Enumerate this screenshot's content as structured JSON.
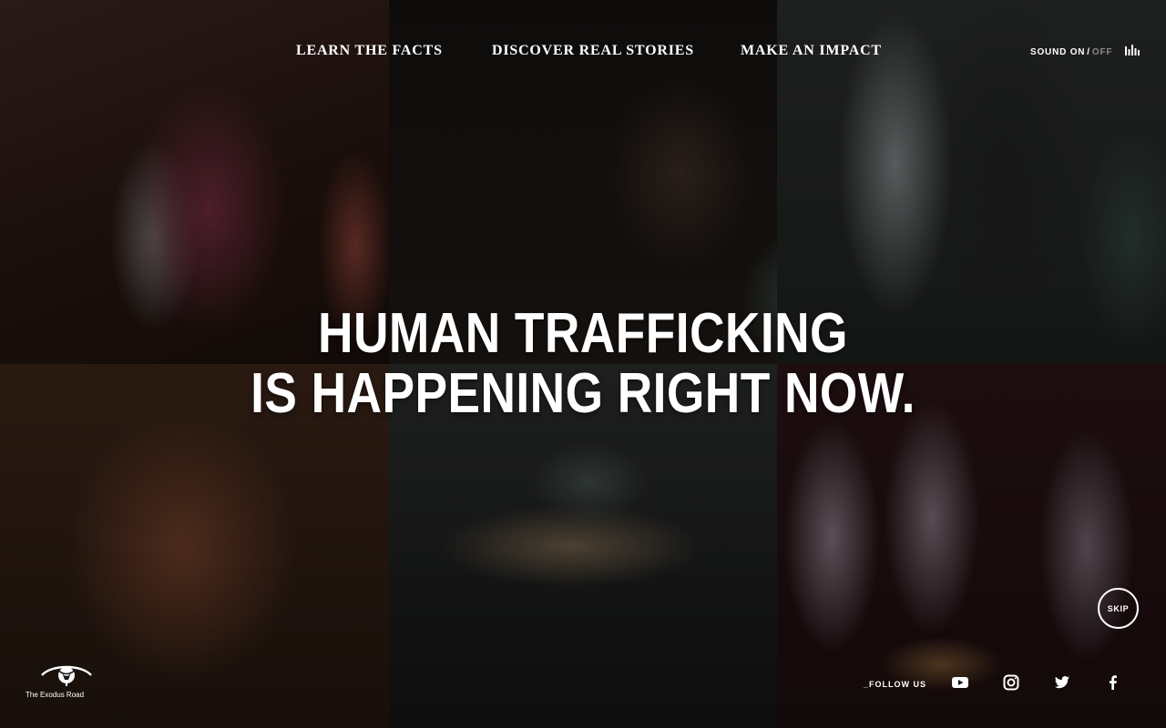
{
  "nav": {
    "items": [
      {
        "label": "LEARN THE FACTS"
      },
      {
        "label": "DISCOVER REAL STORIES"
      },
      {
        "label": "MAKE AN IMPACT"
      }
    ]
  },
  "sound": {
    "on_label": "SOUND ON",
    "separator": "/",
    "off_label": "OFF",
    "icon": "equalizer-icon"
  },
  "hero": {
    "line1": "HUMAN TRAFFICKING",
    "line2": "IS HAPPENING RIGHT NOW."
  },
  "skip": {
    "label": "SKIP"
  },
  "logo": {
    "brand": "The Exodus Road",
    "icon": "eye-logo-icon"
  },
  "footer": {
    "follow_label": "_FOLLOW US",
    "social": [
      {
        "name": "youtube-icon"
      },
      {
        "name": "instagram-icon"
      },
      {
        "name": "twitter-icon"
      },
      {
        "name": "facebook-icon"
      }
    ]
  },
  "colors": {
    "text": "#ffffff",
    "muted": "#8a8a8a"
  }
}
